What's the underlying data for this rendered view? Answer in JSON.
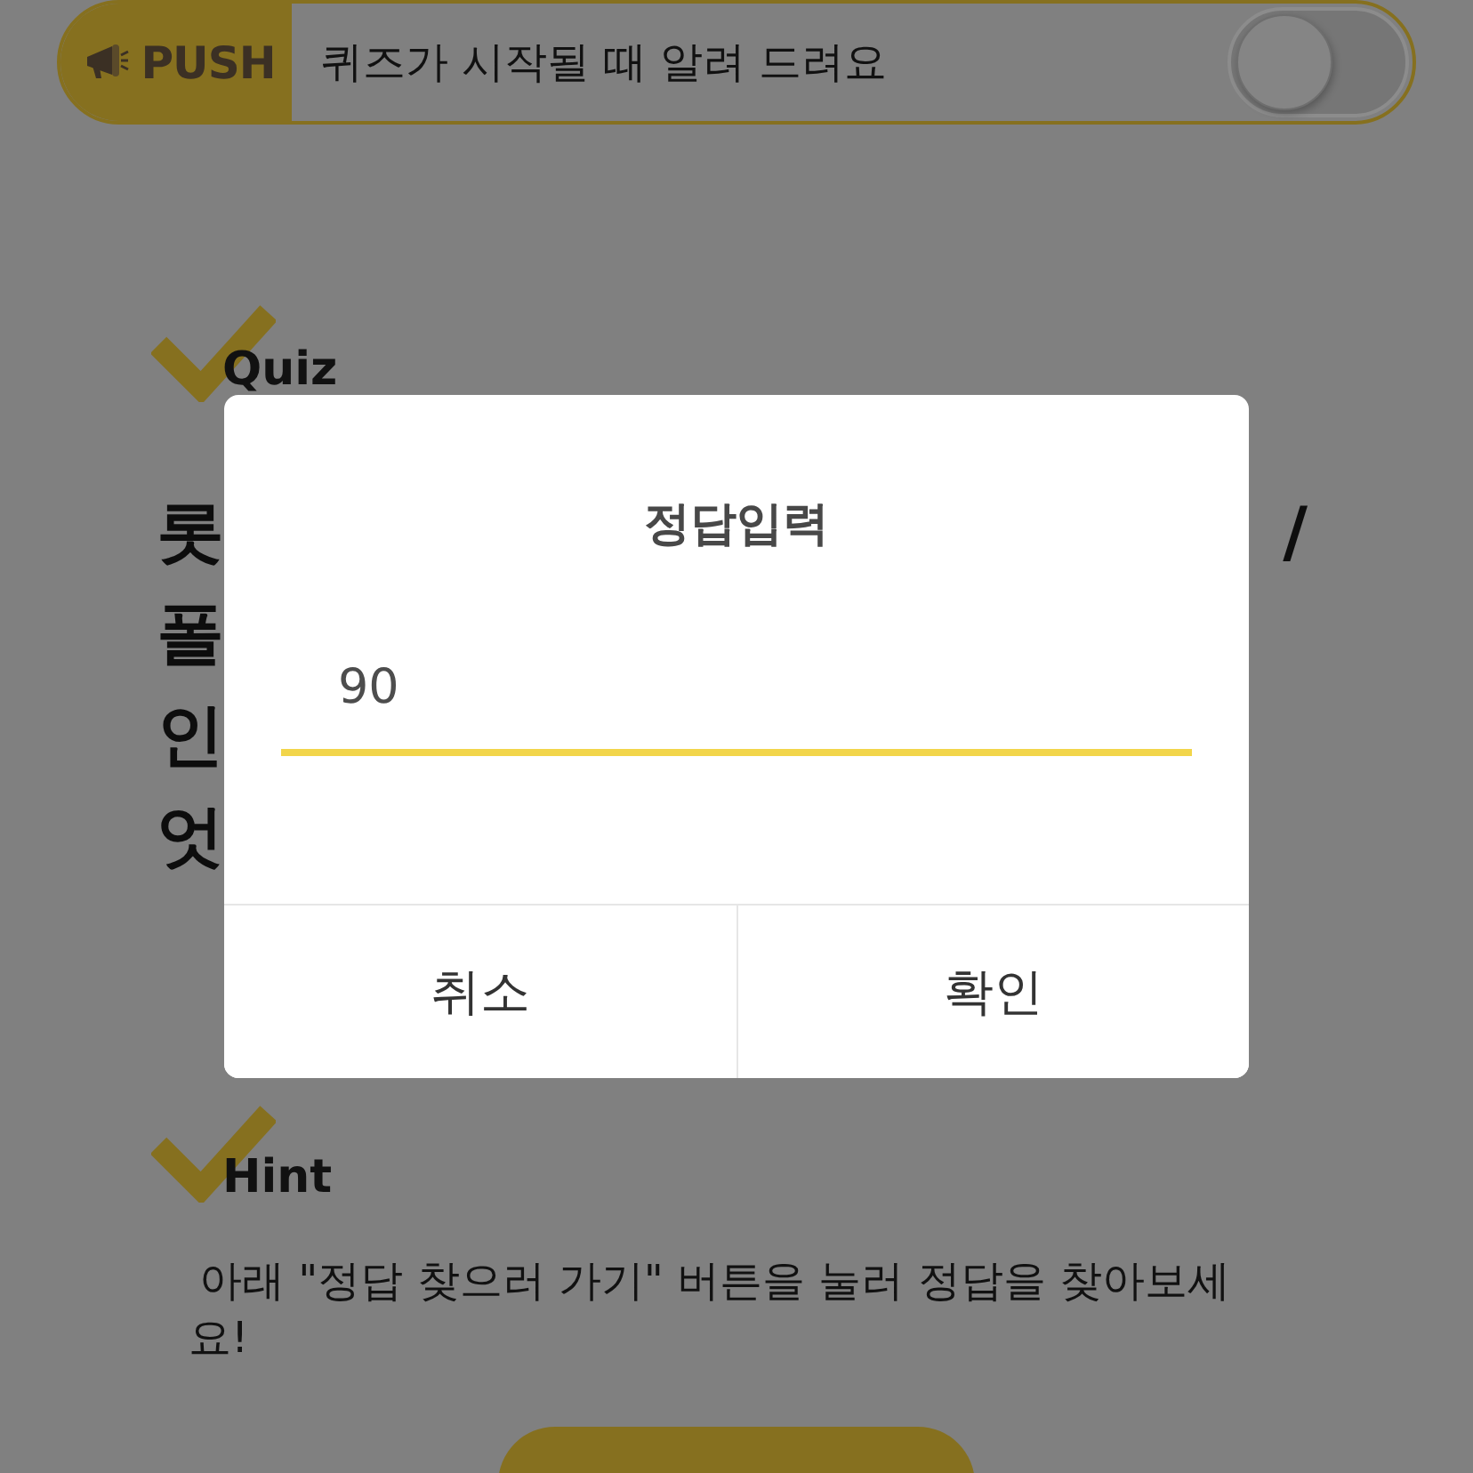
{
  "push": {
    "badge": "PUSH",
    "label": "퀴즈가 시작될 때 알려 드려요",
    "on": false
  },
  "quiz": {
    "heading": "Quiz",
    "question_lines": [
      {
        "start": "롯",
        "end": "/"
      },
      {
        "start": "폴"
      },
      {
        "start": "인"
      },
      {
        "start": "엇"
      }
    ]
  },
  "hint": {
    "heading": "Hint",
    "text": "아래 \"정답 찾으러 가기\" 버튼을 눌러 정답을 찾아보세요!"
  },
  "dialog": {
    "title": "정답입력",
    "answer": {
      "value": "90"
    },
    "buttons": [
      {
        "label": "취소"
      },
      {
        "label": "확인"
      }
    ]
  }
}
